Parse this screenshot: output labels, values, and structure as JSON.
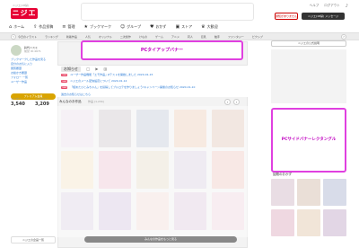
{
  "header": {
    "logo_sub": "ニジエ(18禁)",
    "logo_text": "ニジエ",
    "links": [
      "ヘルプ",
      "ログアウト"
    ],
    "notice_button": "通知がありません",
    "user_button": "ニジエ(18禁) メッセージ"
  },
  "nav": {
    "items": [
      {
        "icon": "home-icon",
        "glyph": "⌂",
        "label": "ホーム"
      },
      {
        "icon": "upload-icon",
        "glyph": "⇪",
        "label": "作品投稿"
      },
      {
        "icon": "list-icon",
        "glyph": "≡",
        "label": "管理"
      },
      {
        "icon": "bookmark-icon",
        "glyph": "★",
        "label": "ブックマーク"
      },
      {
        "icon": "group-icon",
        "glyph": "☺",
        "label": "グループ"
      },
      {
        "icon": "recommend-icon",
        "glyph": "♥",
        "label": "おかず"
      },
      {
        "icon": "store-icon",
        "glyph": "▣",
        "label": "ストア"
      },
      {
        "icon": "ranking-icon",
        "glyph": "♛",
        "label": "大歓迎"
      }
    ]
  },
  "categories": [
    "今日のイラスト",
    "ランキング",
    "新着作品",
    "人気",
    "オリジナル",
    "二次創作",
    "けもの",
    "ゲーム",
    "アニメ",
    "同人",
    "巨乳",
    "触手",
    "ファンタジー",
    "ピクシブ",
    "ジャンル",
    "マンガ",
    "お絵かき",
    "小説"
  ],
  "sidebar": {
    "username": "鈴代ハスミ",
    "user_id": "前髪 ID:4671",
    "links": [
      "ブックマークした作品を見る",
      "自分のお気に入り",
      "閲覧履歴",
      "お絵かき履歴",
      "フォロー 一覧",
      "ユーザー作品"
    ],
    "premium_button": "プレミアム会員",
    "stats": [
      {
        "label": "ユーザー",
        "value": "3,540"
      },
      {
        "label": "フォロワー",
        "value": "3,209"
      }
    ],
    "mini_banner": "ニジエの企画一覧"
  },
  "top_banner": "PCタイアップバナー",
  "news": {
    "tabs": [
      "お知らせ",
      "◯",
      "▶",
      "▥"
    ],
    "items": [
      {
        "tag": "new",
        "text": "ユーザー作品機能「エモ作品」βテストを開始しました 2020-01-15"
      },
      {
        "tag": "new",
        "text": "ニジエのメール配信設定について 2020-01-14"
      },
      {
        "tag": "new",
        "text": "「極めたひとみちゃん」を投稿してブルロテを作りましょう!キャンペーン開催のお知らせ 2020-01-10"
      }
    ],
    "more": "過去のお知らせはこちら"
  },
  "featured": {
    "title": "みんなのお作品",
    "count": "作品 (1,234)",
    "more_button": "みんなの作品をもっと見る"
  },
  "right": {
    "top_button": "ニジエの公式説明",
    "banner": "PCサイドバナーレクタングル",
    "rec_title": "話題のおかず"
  },
  "colors": {
    "accent": "#e60033",
    "banner_outline": "#e040e0",
    "premium": "#d9a400"
  }
}
